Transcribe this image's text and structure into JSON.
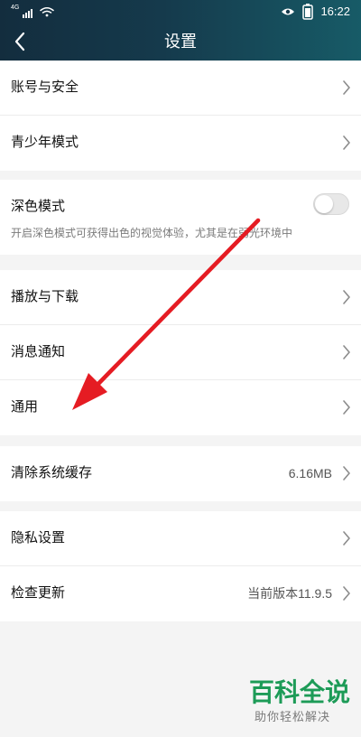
{
  "status_bar": {
    "signal_text": "4G",
    "time": "16:22",
    "icons": [
      "signal-icon",
      "wifi-icon",
      "eye-icon",
      "battery-icon"
    ]
  },
  "header": {
    "title": "设置",
    "back_icon": "chevron-left-icon"
  },
  "settings": {
    "account_security": "账号与安全",
    "youth_mode": "青少年模式",
    "dark_mode": {
      "title": "深色模式",
      "description": "开启深色模式可获得出色的视觉体验，尤其是在弱光环境中",
      "toggle_on": false
    },
    "play_download": "播放与下载",
    "notifications": "消息通知",
    "general": "通用",
    "clear_cache": {
      "label": "清除系统缓存",
      "value": "6.16MB"
    },
    "privacy": "隐私设置",
    "check_update": {
      "label": "检查更新",
      "value": "当前版本11.9.5"
    }
  },
  "annotation": {
    "arrow_color": "#e51c23"
  },
  "watermark": {
    "main": "百科全说",
    "sub": "助你轻松解决"
  },
  "colors": {
    "header_start": "#132d3e",
    "header_end": "#175b67",
    "page_bg": "#f4f4f4",
    "card_bg": "#ffffff",
    "watermark_green": "#1d9b57"
  }
}
